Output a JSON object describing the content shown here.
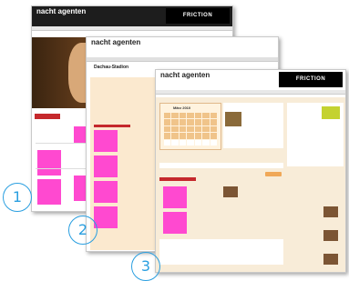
{
  "pages": [
    {
      "logo": "nacht agenten",
      "banner": "FRICTION",
      "number": "1"
    },
    {
      "logo": "nacht agenten",
      "title": "Dachau-Stadion",
      "number": "2"
    },
    {
      "logo": "nacht agenten",
      "banner": "FRICTION",
      "calendar_month": "März 2010",
      "number": "3"
    }
  ]
}
